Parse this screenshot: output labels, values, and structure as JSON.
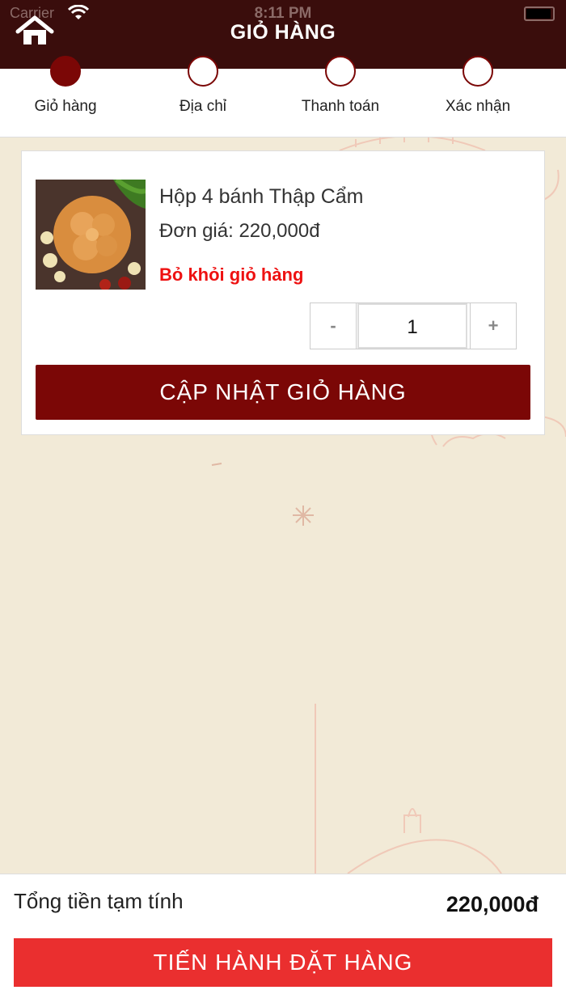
{
  "status": {
    "carrier": "Carrier",
    "time": "8:11 PM"
  },
  "header": {
    "title": "GIỎ HÀNG"
  },
  "steps": [
    {
      "label": "Giỏ hàng",
      "active": true
    },
    {
      "label": "Địa chỉ",
      "active": false
    },
    {
      "label": "Thanh toán",
      "active": false
    },
    {
      "label": "Xác nhận",
      "active": false
    }
  ],
  "cart": {
    "item": {
      "name": "Hộp 4 bánh Thập Cẩm",
      "price": "Đơn giá: 220,000đ",
      "remove_label": "Bỏ khỏi giỏ hàng",
      "quantity": "1",
      "minus": "-",
      "plus": "+"
    },
    "update_label": "CẬP NHẬT GIỎ HÀNG"
  },
  "footer": {
    "total_label": "Tổng tiền tạm tính",
    "total_value": "220,000đ",
    "checkout_label": "TIẾN HÀNH ĐẶT HÀNG"
  },
  "colors": {
    "header": "#3a0d0c",
    "accent": "#7b0706",
    "checkout": "#ea2f2f",
    "remove": "#e11111",
    "background": "#f2ead7"
  },
  "icons": {
    "home": "home-icon",
    "wifi": "wifi-icon",
    "battery": "battery-icon"
  }
}
